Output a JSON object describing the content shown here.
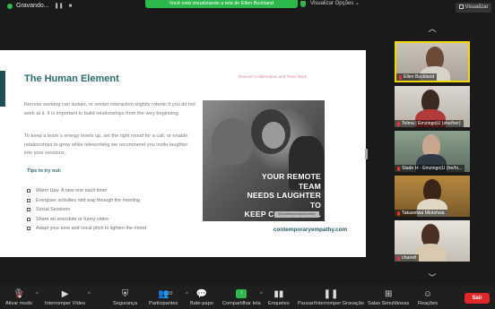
{
  "top_bar": {
    "recording_label": "Gravando...",
    "share_banner": "Você está visualizando a tela de Ellen Buckland",
    "view_options": "Visualizar Opções",
    "view_button": "Visualizar"
  },
  "slide": {
    "title": "The Human Element",
    "subtitle": "Remote Collaboration and Team Work",
    "paragraph1": "Remote working can isolate, or render interaction slightly robotic if you do not work at it. It is important to build relationships from the very beginning.",
    "paragraph2": "To keep a team´s energy levels up, set the right mood for a call, or enable relationships to grow while teleworking we recommend you invite laughter into your sessions.",
    "tips_heading": "Tips to try out:",
    "tips": [
      "Warm Ups: A new one each time!",
      "Energiser activities mid way through the meeting",
      "Social Sessions",
      "Share an anecdote or funny video",
      "Adapt your tone and vocal pitch to lighten the mood"
    ],
    "photo_text_line1": "YOUR REMOTE TEAM",
    "photo_text_line2": "NEEDS LAUGHTER TO",
    "photo_text_line3": "KEEP CONNECTED.",
    "photo_handle": "@contemporaryempathy",
    "website": "contemporaryempathy.com"
  },
  "gallery": {
    "participants": [
      {
        "name": "Ellen Buckland",
        "muted": true,
        "active": true
      },
      {
        "name": "Telma | Emzingo|U (she/her)",
        "muted": true,
        "active": false
      },
      {
        "name": "Slade H - Emzingo|U (he/hi...",
        "muted": true,
        "active": false
      },
      {
        "name": "Takazelwa Mlotshwa",
        "muted": true,
        "active": false
      },
      {
        "name": "chanell",
        "muted": true,
        "active": false
      }
    ]
  },
  "toolbar": {
    "unmute": "Ativar mudo",
    "stop_video": "Interromper Vídeo",
    "security": "Segurança",
    "participants": "Participantes",
    "participants_count": "33",
    "chat": "Bate-papo",
    "share_screen": "Compartilhar tela",
    "polls": "Enquetes",
    "pause_recording": "Pausar/Interromper Gravação",
    "breakout_rooms": "Salas Simultâneas",
    "reactions": "Reações",
    "leave": "Sair"
  },
  "colors": {
    "accent_teal": "#2a6b72",
    "share_green": "#2db84b",
    "active_speaker": "#f3d800",
    "leave_red": "#e02828"
  }
}
